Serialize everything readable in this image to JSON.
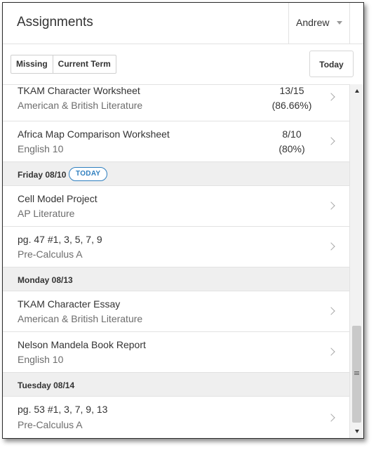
{
  "header": {
    "title": "Assignments",
    "user": "Andrew"
  },
  "filters": {
    "missing": "Missing",
    "current_term": "Current Term",
    "today": "Today"
  },
  "items": [
    {
      "title": "TKAM Character Worksheet",
      "course": "American & British Literature",
      "score": "13/15",
      "percent": "(86.66%)"
    },
    {
      "title": "Africa Map Comparison Worksheet",
      "course": "English 10",
      "score": "8/10",
      "percent": "(80%)"
    },
    {
      "title": "Cell Model Project",
      "course": "AP Literature"
    },
    {
      "title": "pg. 47 #1, 3, 5, 7, 9",
      "course": "Pre-Calculus A"
    },
    {
      "title": "TKAM Character Essay",
      "course": "American & British Literature"
    },
    {
      "title": "Nelson Mandela Book Report",
      "course": "English 10"
    },
    {
      "title": "pg. 53 #1, 3, 7, 9, 13",
      "course": "Pre-Calculus A"
    }
  ],
  "days": [
    {
      "label": "Friday 08/10",
      "badge": "TODAY"
    },
    {
      "label": "Monday 08/13"
    },
    {
      "label": "Tuesday 08/14"
    }
  ],
  "colors": {
    "accent": "#2f7fbf",
    "day_bg": "#efefef"
  },
  "icons": {
    "row_arrow": "chevron-right-icon",
    "user_dropdown": "caret-down-icon"
  }
}
